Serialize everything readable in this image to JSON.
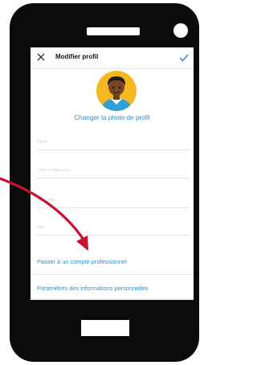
{
  "header": {
    "title": "Modifier profil",
    "close_icon": "close-icon",
    "confirm_icon": "checkmark-icon"
  },
  "profile": {
    "change_photo_label": "Changer la photo de profil",
    "avatar_icon": "avatar-illustration"
  },
  "fields": [
    {
      "placeholder": "Nom"
    },
    {
      "placeholder": "Nom d'utilisateur"
    },
    {
      "placeholder": "Site web"
    },
    {
      "placeholder": "Bio"
    }
  ],
  "links": {
    "professional": "Passer à un compte professionnel",
    "personal_info": "Paramètres des informations personnelles"
  },
  "colors": {
    "accent": "#2d8fcb",
    "phone_body": "#0b0b0b",
    "annotation_arrow": "#c4122f",
    "avatar_background": "#f5b820"
  }
}
